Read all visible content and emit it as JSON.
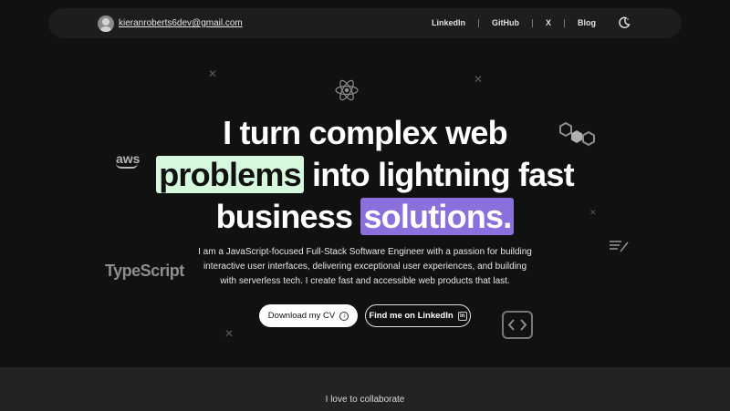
{
  "nav": {
    "email": "kieranroberts6dev@gmail.com",
    "links": [
      "LinkedIn",
      "GitHub",
      "X",
      "Blog"
    ],
    "theme_icon": "moon-icon"
  },
  "decorations": {
    "aws_label": "aws",
    "typescript_label": "TypeScript",
    "icons": [
      "react-icon",
      "nodejs-icon",
      "code-brackets-icon",
      "notes-icon",
      "cross-icon"
    ]
  },
  "hero": {
    "line1": "I turn complex web",
    "line2_highlight": "problems",
    "line2_rest": "into lightning fast",
    "line3_start": "business",
    "line3_highlight": "solutions.",
    "description": "I am a JavaScript-focused Full-Stack Software Engineer with a passion for building interactive user interfaces, delivering exceptional user experiences, and building with serverless tech. I create fast and accessible web products that last.",
    "cv_button": "Download my CV",
    "linkedin_button": "Find me on LinkedIn"
  },
  "colors": {
    "background": "#111111",
    "highlight_green": "#d6f9de",
    "highlight_purple": "#8b6fdc"
  },
  "footer": {
    "text": "I love to collaborate"
  }
}
